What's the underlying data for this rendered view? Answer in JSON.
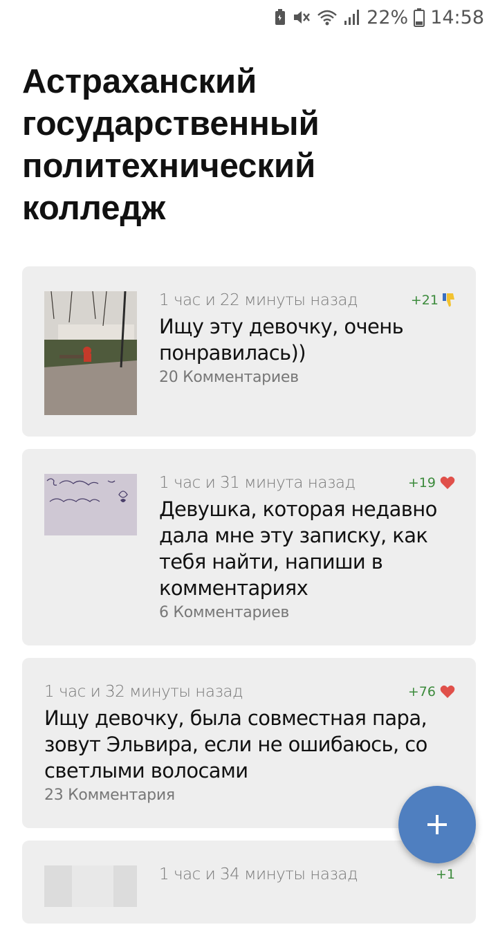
{
  "status_bar": {
    "battery_pct": "22%",
    "time": "14:58"
  },
  "page": {
    "title": "Астраханский государственный политехнический колледж"
  },
  "posts": [
    {
      "time": "1 час и 22 минуты назад",
      "score": "+21",
      "reaction": "thumbs-down-icon",
      "text": "Ищу эту девочку, очень понравилась))",
      "comments": "20 Комментариев",
      "has_image": true
    },
    {
      "time": "1 час и 31 минута назад",
      "score": "+19",
      "reaction": "heart-icon",
      "text": "Девушка, которая недавно дала мне эту записку, как тебя найти, напиши в комментариях",
      "comments": "6 Комментариев",
      "has_image": true
    },
    {
      "time": "1 час и 32 минуты назад",
      "score": "+76",
      "reaction": "heart-icon",
      "text": "Ищу девочку, была совместная пара, зовут Эльвира, если не ошибаюсь, со светлыми волосами",
      "comments": "23 Комментария",
      "has_image": false
    },
    {
      "time": "1 час и 34 минуты назад",
      "score": "+1",
      "has_image": true
    }
  ],
  "colors": {
    "card_bg": "#eeeeee",
    "fab": "#4f7fc0",
    "score_green": "#3b8a3b",
    "heart": "#e0504a",
    "thumb_yellow": "#f2c230",
    "thumb_blue": "#3a6fc0"
  }
}
